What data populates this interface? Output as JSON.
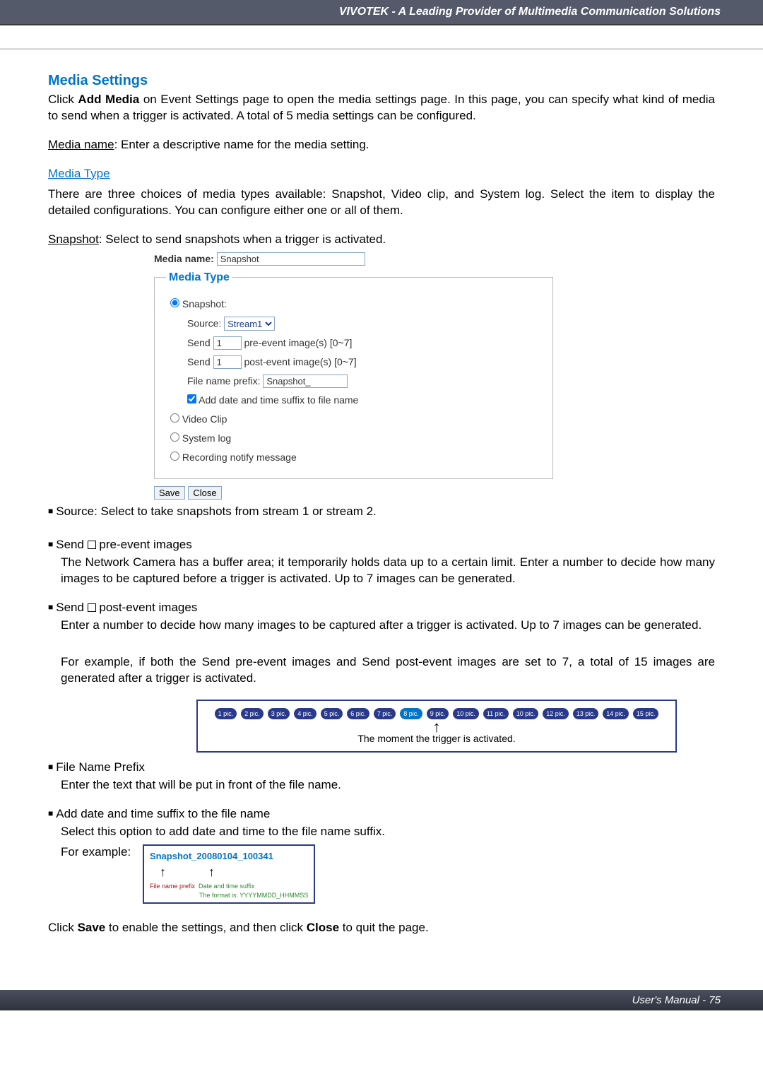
{
  "header": {
    "title": "VIVOTEK - A Leading Provider of Multimedia Communication Solutions"
  },
  "section": {
    "title": "Media Settings"
  },
  "intro": {
    "click": "Click ",
    "add_media": "Add Media",
    "rest": " on Event Settings page to open the media settings page. In this page, you can specify what kind of media to send when a trigger is activated. A total of 5 media settings can be configured."
  },
  "media_name_line": {
    "label": "Media name",
    "text": ": Enter a descriptive name for the media setting."
  },
  "media_type_heading": "Media Type",
  "media_type_desc": "There are three choices of media types available: Snapshot, Video clip, and System log. Select the item to display the detailed configurations. You can configure either one or all of them.",
  "snapshot_line": {
    "label": "Snapshot",
    "text": ": Select to send snapshots when a trigger is activated."
  },
  "form": {
    "media_name_label": "Media name:",
    "media_name_value": "Snapshot",
    "legend": "Media Type",
    "snapshot_radio": "Snapshot:",
    "source_label": "Source:",
    "source_value": "Stream1",
    "send_pre_label": "Send",
    "pre_value": "1",
    "pre_suffix": "pre-event image(s) [0~7]",
    "send_post_label": "Send",
    "post_value": "1",
    "post_suffix": "post-event image(s) [0~7]",
    "prefix_label": "File name prefix:",
    "prefix_value": "Snapshot_",
    "add_suffix_label": "Add date and time suffix to file name",
    "video_clip": "Video Clip",
    "system_log": "System log",
    "recording_notify": "Recording notify message",
    "save": "Save",
    "close": "Close"
  },
  "body": {
    "source": "Source: Select to take snapshots from stream 1 or stream 2.",
    "send_pre_title": "Send ",
    "send_pre_after": " pre-event images",
    "send_pre_desc": "The Network Camera has a buffer area; it temporarily holds data up to a certain limit. Enter a number to decide how many images to be captured before a trigger is activated. Up to 7 images can be generated.",
    "send_post_title": "Send ",
    "send_post_after": " post-event images",
    "send_post_desc": "Enter a number to decide how many images to be captured after a trigger is activated. Up to 7 images can be generated.",
    "example15": "For example, if both the Send pre-event images and Send post-event images are set to 7, a total of 15 images are generated after a trigger is activated.",
    "filename_prefix_title": "File Name Prefix",
    "filename_prefix_desc": "Enter the text that will be put in front of the file name.",
    "add_suffix_title": "Add date and time suffix to the file name",
    "add_suffix_desc": "Select this option to add date and time to the file name suffix.",
    "for_example": "For example:",
    "save_close": {
      "p1": "Click ",
      "save": "Save",
      "p2": " to enable the settings,  and then click ",
      "close": "Close",
      "p3": " to quit the page."
    }
  },
  "chart_data": {
    "type": "bar",
    "categories": [
      "1 pic.",
      "2 pic.",
      "3 pic.",
      "4 pic.",
      "5 pic.",
      "6 pic.",
      "7 pic.",
      "8 pic.",
      "9 pic.",
      "10 pic.",
      "11 pic.",
      "10 pic.",
      "12 pic.",
      "13 pic.",
      "14 pic.",
      "15 pic."
    ],
    "values": [
      1,
      1,
      1,
      1,
      1,
      1,
      1,
      2,
      1,
      1,
      1,
      1,
      1,
      1,
      1,
      1
    ],
    "title": "",
    "xlabel": "",
    "ylabel": "",
    "annotation": "The moment the trigger is activated.",
    "active_index": 7
  },
  "example_box": {
    "filename": "Snapshot_20080104_100341",
    "prefix_label": "File name prefix",
    "dt_label": "Date and time suffix",
    "format": "The format is: YYYYMMDD_HHMMSS"
  },
  "footer": {
    "text": "User's Manual - 75"
  }
}
